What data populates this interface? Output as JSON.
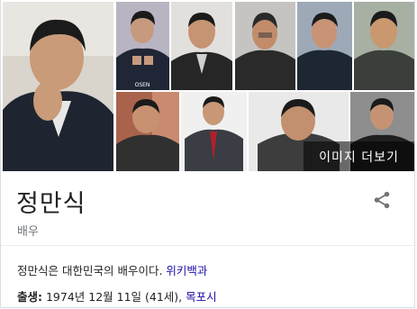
{
  "images": {
    "more_label": "이미지 더보기",
    "watermark_tile6": "OSEN"
  },
  "entity": {
    "name": "정만식",
    "type": "배우",
    "description_text": "정만식은 대한민국의 배우이다. ",
    "description_source": "위키백과"
  },
  "born": {
    "label": "출생:",
    "value": " 1974년 12월 11일 (41세), ",
    "place": "목포시"
  },
  "icons": {
    "share": "share-icon"
  },
  "colors": {
    "link": "#1a0dab",
    "subtle_text": "#70757a",
    "divider": "#ebebeb"
  }
}
